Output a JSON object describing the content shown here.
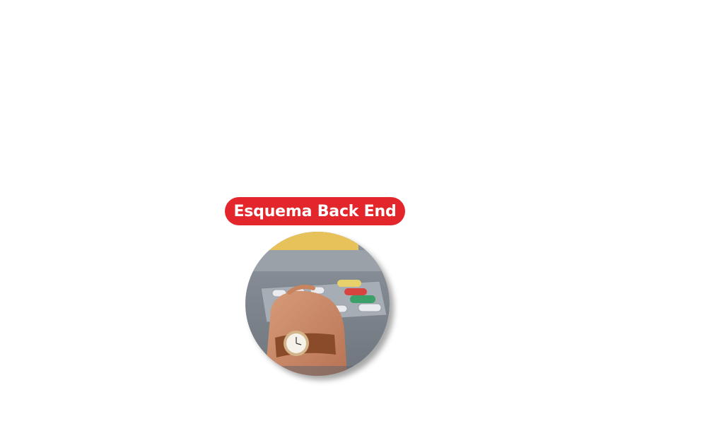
{
  "badge": {
    "label": "Esquema Back End",
    "color": "#e3262b"
  },
  "image": {
    "subject": "atm-keypad-hand-photo"
  }
}
